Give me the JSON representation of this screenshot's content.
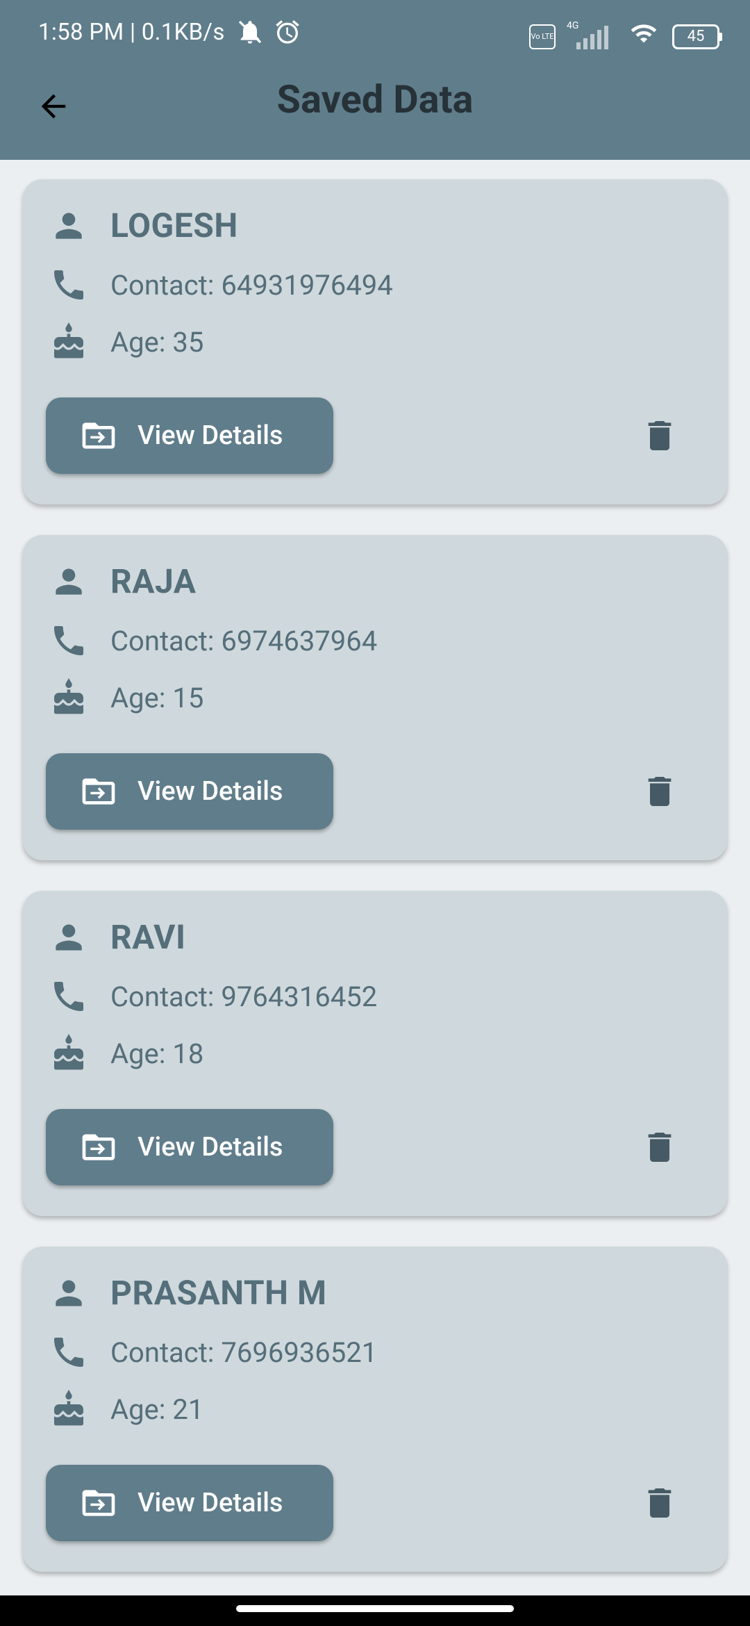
{
  "status_bar": {
    "time": "1:58 PM | 0.1KB/s",
    "network": "4G",
    "volte": "Vo LTE",
    "battery": "45"
  },
  "app_bar": {
    "title": "Saved Data",
    "back_icon": "arrow-back-icon"
  },
  "records": [
    {
      "name": "LOGESH",
      "contact": "Contact: 64931976494",
      "age": "Age: 35",
      "button": "View Details"
    },
    {
      "name": "RAJA",
      "contact": "Contact: 6974637964",
      "age": "Age: 15",
      "button": "View Details"
    },
    {
      "name": "RAVI",
      "contact": "Contact: 9764316452",
      "age": "Age: 18",
      "button": "View Details"
    },
    {
      "name": "PRASANTH M",
      "contact": "Contact: 7696936521",
      "age": "Age: 21",
      "button": "View Details"
    }
  ],
  "colors": {
    "app_bar": "#607D8B",
    "background": "#ECEFF1",
    "card": "#CFD8DC",
    "title_text": "#263238",
    "card_text": "#546E7A",
    "icon": "#546E7A",
    "button": "#607D8B"
  }
}
